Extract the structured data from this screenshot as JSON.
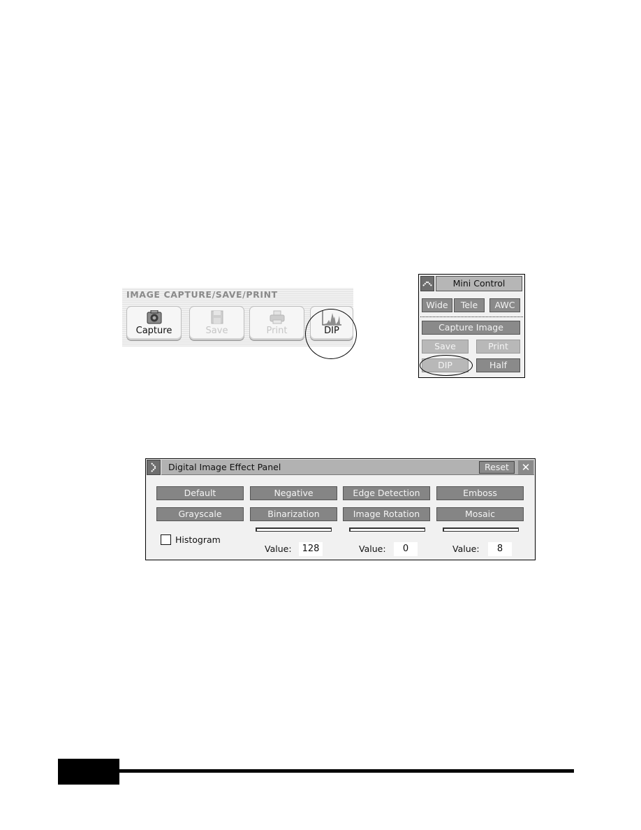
{
  "capture_toolbar": {
    "title": "IMAGE CAPTURE/SAVE/PRINT",
    "buttons": [
      {
        "label": "Capture",
        "icon": "camera-icon",
        "enabled": true
      },
      {
        "label": "Save",
        "icon": "floppy-disk-icon",
        "enabled": false
      },
      {
        "label": "Print",
        "icon": "printer-icon",
        "enabled": false
      },
      {
        "label": "DIP",
        "icon": "histogram-icon",
        "enabled": true,
        "highlighted": true
      }
    ]
  },
  "mini_control": {
    "title": "Mini Control",
    "collapse_icon": "chevron-up-icon",
    "buttons": {
      "wide": "Wide",
      "tele": "Tele",
      "awc": "AWC",
      "capture_image": "Capture Image",
      "save": "Save",
      "print": "Print",
      "dip": "DIP",
      "half": "Half"
    }
  },
  "dip_panel": {
    "title": "Digital Image Effect Panel",
    "expand_icon": "chevron-right-icon",
    "reset_label": "Reset",
    "close_icon": "close-icon",
    "effects_row1": [
      "Default",
      "Negative",
      "Edge Detection",
      "Emboss"
    ],
    "effects_row2": [
      "Grayscale",
      "Binarization",
      "Image Rotation",
      "Mosaic"
    ],
    "histogram_label": "Histogram",
    "histogram_checked": false,
    "value_label": "Value:",
    "values": {
      "binarization": "128",
      "image_rotation": "0",
      "mosaic": "8"
    }
  }
}
